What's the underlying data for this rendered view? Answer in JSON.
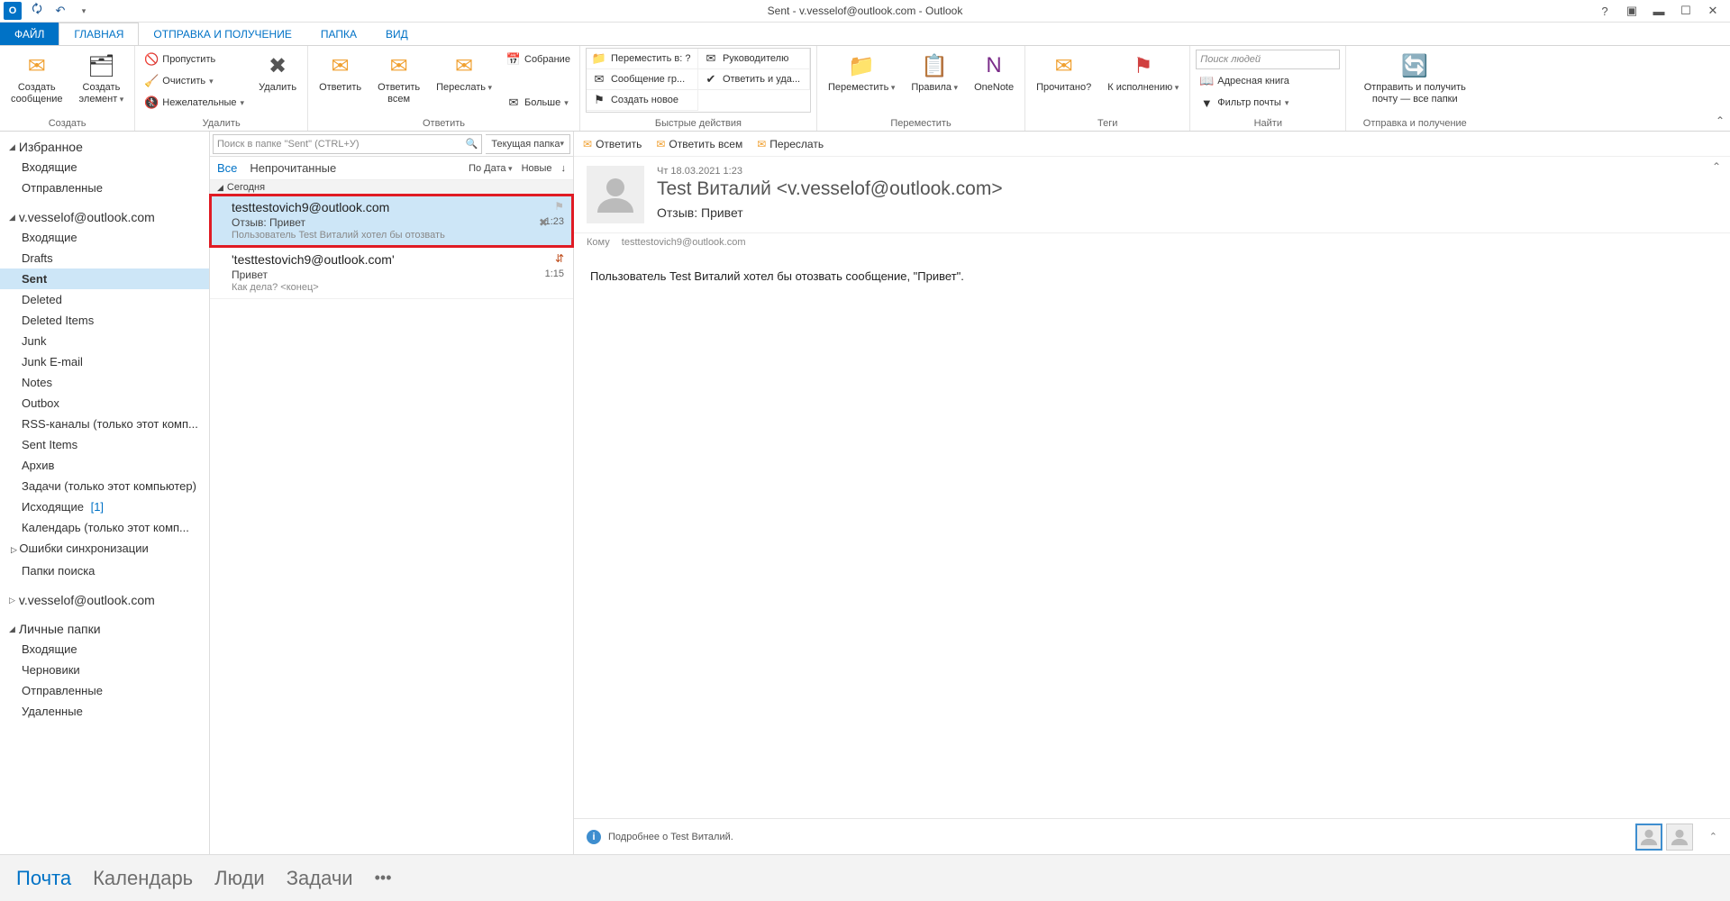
{
  "title": "Sent - v.vesselof@outlook.com - Outlook",
  "app_icon": "O",
  "tabs": {
    "file": "ФАЙЛ",
    "home": "ГЛАВНАЯ",
    "sendrcv": "ОТПРАВКА И ПОЛУЧЕНИЕ",
    "folder": "ПАПКА",
    "view": "ВИД"
  },
  "ribbon": {
    "create": {
      "new_mail": "Создать\nсообщение",
      "new_item": "Создать\nэлемент",
      "group": "Создать"
    },
    "delete": {
      "ignore": "Пропустить",
      "clean": "Очистить",
      "junk": "Нежелательные",
      "del": "Удалить",
      "group": "Удалить"
    },
    "respond": {
      "reply": "Ответить",
      "reply_all": "Ответить\nвсем",
      "forward": "Переслать",
      "meeting": "Собрание",
      "more": "Больше",
      "group": "Ответить"
    },
    "quick": {
      "move_to": "Переместить в: ?",
      "manager": "Руководителю",
      "team": "Сообщение гр...",
      "reply_del": "Ответить и уда...",
      "new": "Создать новое",
      "group": "Быстрые действия"
    },
    "move": {
      "move": "Переместить",
      "rules": "Правила",
      "onenote": "OneNote",
      "group": "Переместить"
    },
    "tags": {
      "read": "Прочитано?",
      "followup": "К исполнению",
      "group": "Теги"
    },
    "find": {
      "search_ph": "Поиск людей",
      "addr": "Адресная книга",
      "filter": "Фильтр почты",
      "group": "Найти"
    },
    "sendrec": {
      "btn": "Отправить и получить\nпочту — все папки",
      "group": "Отправка и получение"
    }
  },
  "nav": {
    "favorites": "Избранное",
    "fav_items": [
      "Входящие",
      "Отправленные"
    ],
    "account1": "v.vesselof@outlook.com",
    "folders1": [
      {
        "n": "Входящие"
      },
      {
        "n": "Drafts"
      },
      {
        "n": "Sent",
        "sel": true
      },
      {
        "n": "Deleted"
      },
      {
        "n": "Deleted Items"
      },
      {
        "n": "Junk"
      },
      {
        "n": "Junk E-mail"
      },
      {
        "n": "Notes"
      },
      {
        "n": "Outbox"
      },
      {
        "n": "RSS-каналы (только этот комп..."
      },
      {
        "n": "Sent Items"
      },
      {
        "n": "Архив"
      },
      {
        "n": "Задачи (только этот компьютер)"
      },
      {
        "n": "Исходящие",
        "c": "[1]"
      },
      {
        "n": "Календарь (только этот комп..."
      },
      {
        "n": "Ошибки синхронизации",
        "exp": true
      },
      {
        "n": "Папки поиска"
      }
    ],
    "account2": "v.vesselof@outlook.com",
    "local": "Личные папки",
    "local_items": [
      "Входящие",
      "Черновики",
      "Отправленные",
      "Удаленные"
    ]
  },
  "list": {
    "search_ph": "Поиск в папке \"Sent\" (CTRL+У)",
    "scope": "Текущая папка",
    "all": "Все",
    "unread": "Непрочитанные",
    "sort_by": "По Дата",
    "newest": "Новые",
    "group_today": "Сегодня",
    "items": [
      {
        "from": "testtestovich9@outlook.com",
        "subj": "Отзыв: Привет",
        "prev": "Пользователь Test Виталий хотел бы отозвать",
        "time": "1:23",
        "sel": true
      },
      {
        "from": "'testtestovich9@outlook.com'",
        "subj": "Привет",
        "prev": "Как дела?  <конец>",
        "time": "1:15",
        "sel": false
      }
    ]
  },
  "read": {
    "reply": "Ответить",
    "reply_all": "Ответить всем",
    "forward": "Переслать",
    "date": "Чт 18.03.2021 1:23",
    "from": "Test Виталий <v.vesselof@outlook.com>",
    "subject": "Отзыв: Привет",
    "to_lbl": "Кому",
    "to": "testtestovich9@outlook.com",
    "body": "Пользователь Test Виталий хотел бы отозвать сообщение, \"Привет\".",
    "footer": "Подробнее о Test Виталий."
  },
  "bottom": {
    "mail": "Почта",
    "cal": "Календарь",
    "people": "Люди",
    "tasks": "Задачи"
  }
}
